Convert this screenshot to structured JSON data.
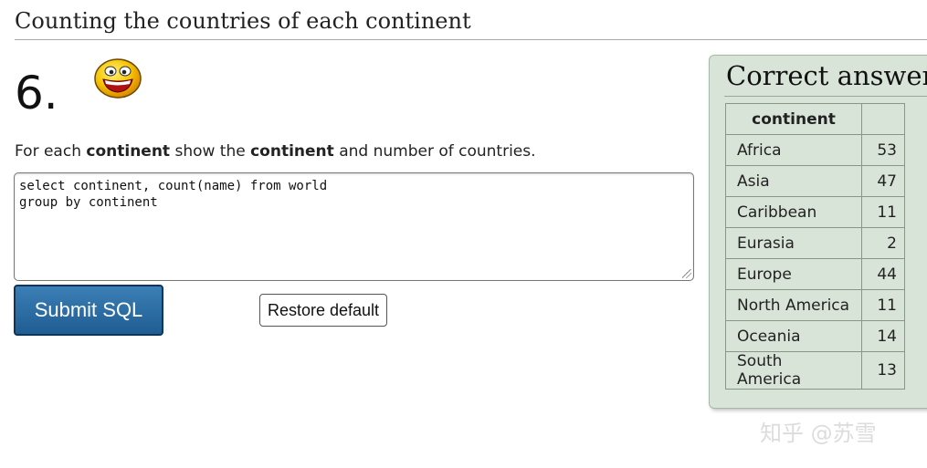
{
  "header": {
    "title": "Counting the countries of each continent"
  },
  "question": {
    "number": "6.",
    "text_parts": [
      "For each ",
      "continent",
      " show the ",
      "continent",
      " and number of countries."
    ]
  },
  "editor": {
    "sql_text": "select continent, count(name) from world\ngroup by continent"
  },
  "buttons": {
    "submit_label": "Submit SQL",
    "restore_label": "Restore default"
  },
  "answer": {
    "title": "Correct answer",
    "columns": [
      "continent",
      ""
    ],
    "rows": [
      {
        "continent": "Africa",
        "count": "53"
      },
      {
        "continent": "Asia",
        "count": "47"
      },
      {
        "continent": "Caribbean",
        "count": "11"
      },
      {
        "continent": "Eurasia",
        "count": "2"
      },
      {
        "continent": "Europe",
        "count": "44"
      },
      {
        "continent": "North America",
        "count": "11"
      },
      {
        "continent": "Oceania",
        "count": "14"
      },
      {
        "continent": "South America",
        "count": "13"
      }
    ]
  },
  "watermark": {
    "text": "知乎 @苏雪"
  },
  "icons": {
    "smiley": "smiley-face-icon"
  },
  "colors": {
    "submit_bg": "#2a6aa3",
    "panel_bg": "#d9e4d9"
  }
}
